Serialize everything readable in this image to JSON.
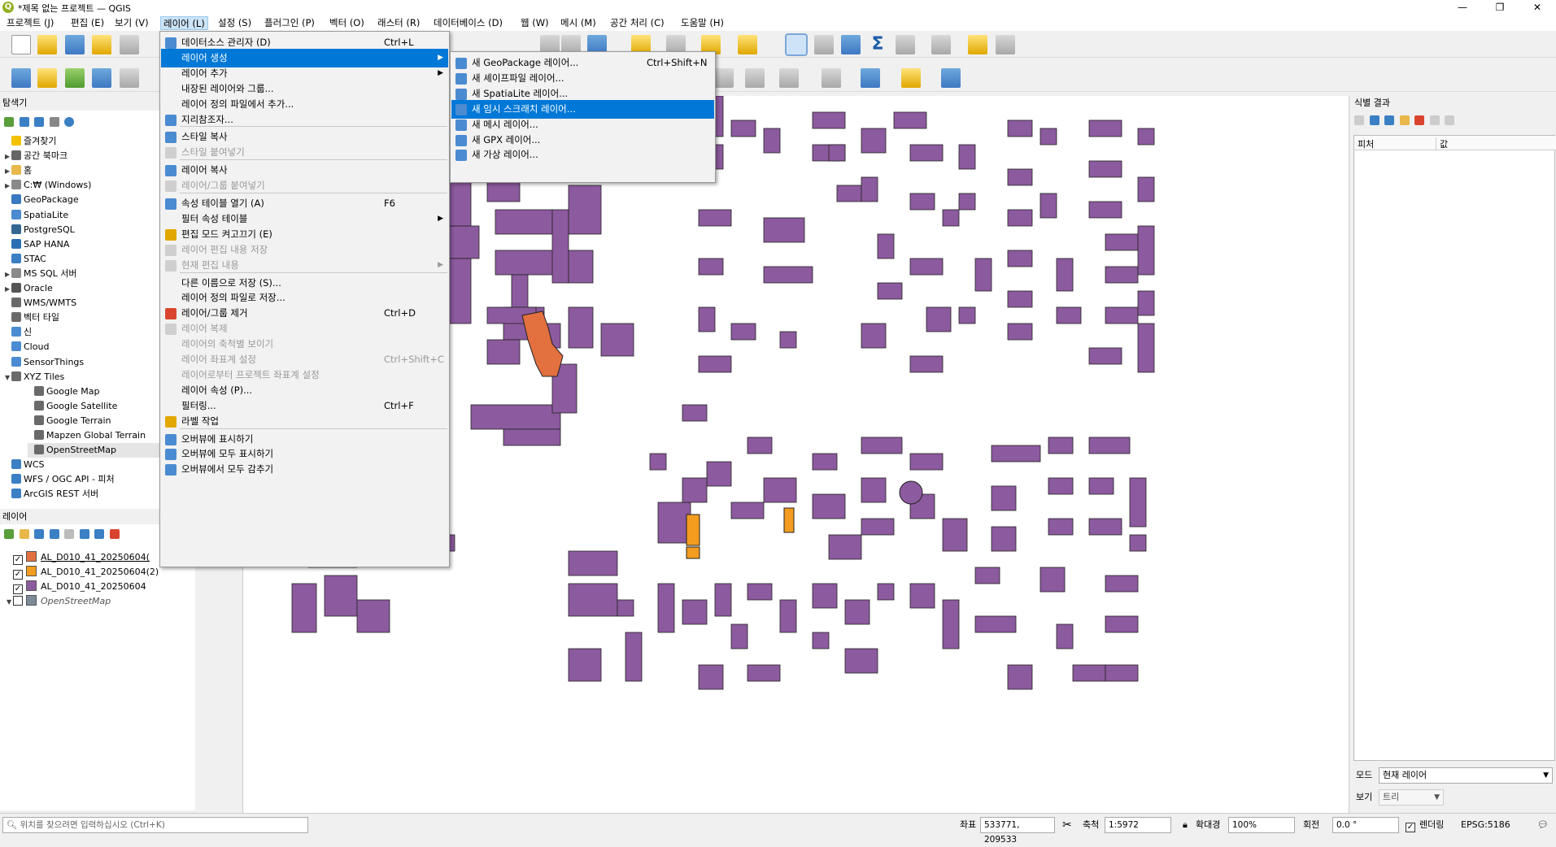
{
  "window": {
    "title": "*제목 없는 프로젝트 — QGIS",
    "logo": "Q"
  },
  "menubar": [
    "프로젝트 (J)",
    "편집 (E)",
    "보기 (V)",
    "레이어 (L)",
    "설정 (S)",
    "플러그인 (P)",
    "벡터 (O)",
    "래스터 (R)",
    "데이터베이스 (D)",
    "웹 (W)",
    "메시 (M)",
    "공간 처리 (C)",
    "도움말 (H)"
  ],
  "browser": {
    "title": "탐색기",
    "items": [
      {
        "label": "즐겨찾기",
        "icon": "star-icon",
        "color": "#f2c200",
        "arrow": ""
      },
      {
        "label": "공간 북마크",
        "icon": "bookmark-icon",
        "color": "#666666",
        "arrow": "▶"
      },
      {
        "label": "홈",
        "icon": "folder-icon",
        "color": "#e8b84a",
        "arrow": "▶"
      },
      {
        "label": "C:₩ (Windows)",
        "icon": "drive-icon",
        "color": "#8a8a8a",
        "arrow": "▶"
      },
      {
        "label": "GeoPackage",
        "icon": "geopackage-icon",
        "color": "#3a79c2",
        "arrow": ""
      },
      {
        "label": "SpatiaLite",
        "icon": "spatialite-icon",
        "color": "#4b8bd1",
        "arrow": ""
      },
      {
        "label": "PostgreSQL",
        "icon": "postgres-icon",
        "color": "#336791",
        "arrow": ""
      },
      {
        "label": "SAP HANA",
        "icon": "hana-icon",
        "color": "#2a6fb5",
        "arrow": ""
      },
      {
        "label": "STAC",
        "icon": "stac-icon",
        "color": "#3b7fc4",
        "arrow": ""
      },
      {
        "label": "MS SQL 서버",
        "icon": "mssql-icon",
        "color": "#8a8a8a",
        "arrow": "▶"
      },
      {
        "label": "Oracle",
        "icon": "oracle-icon",
        "color": "#555555",
        "arrow": "▶"
      },
      {
        "label": "WMS/WMTS",
        "icon": "wms-icon",
        "color": "#6a6a6a",
        "arrow": ""
      },
      {
        "label": "벡터 타일",
        "icon": "vector-tile-icon",
        "color": "#6a6a6a",
        "arrow": ""
      },
      {
        "label": "신",
        "icon": "scene-icon",
        "color": "#4b8bd1",
        "arrow": ""
      },
      {
        "label": "Cloud",
        "icon": "cloud-icon",
        "color": "#4b8bd1",
        "arrow": ""
      },
      {
        "label": "SensorThings",
        "icon": "sensorthings-icon",
        "color": "#4b8bd1",
        "arrow": ""
      },
      {
        "label": "XYZ Tiles",
        "icon": "xyz-tiles-icon",
        "color": "#6a6a6a",
        "arrow": "▼"
      },
      {
        "label": "Google Map",
        "icon": "grid-icon",
        "color": "#6a6a6a",
        "arrow": "",
        "indent": true
      },
      {
        "label": "Google Satellite",
        "icon": "grid-icon",
        "color": "#6a6a6a",
        "arrow": "",
        "indent": true
      },
      {
        "label": "Google Terrain",
        "icon": "grid-icon",
        "color": "#6a6a6a",
        "arrow": "",
        "indent": true
      },
      {
        "label": "Mapzen Global Terrain",
        "icon": "grid-icon",
        "color": "#6a6a6a",
        "arrow": "",
        "indent": true
      },
      {
        "label": "OpenStreetMap",
        "icon": "grid-icon",
        "color": "#6a6a6a",
        "arrow": "",
        "indent": true,
        "selected": true
      },
      {
        "label": "WCS",
        "icon": "wcs-icon",
        "color": "#3b7fc4",
        "arrow": ""
      },
      {
        "label": "WFS / OGC API - 피처",
        "icon": "wfs-icon",
        "color": "#3b7fc4",
        "arrow": ""
      },
      {
        "label": "ArcGIS REST 서버",
        "icon": "arcgis-icon",
        "color": "#3b7fc4",
        "arrow": ""
      }
    ]
  },
  "layers": {
    "title": "레이어",
    "items": [
      {
        "label": "AL_D010_41_20250604(",
        "color": "#e3703f",
        "checked": "✓",
        "italic": false
      },
      {
        "label": "AL_D010_41_20250604(2)",
        "color": "#f39c1f",
        "checked": "✓",
        "italic": false
      },
      {
        "label": "AL_D010_41_20250604",
        "color": "#8c5a9e",
        "checked": "✓",
        "italic": false
      },
      {
        "label": "OpenStreetMap",
        "color": "#7d8a99",
        "checked": "",
        "italic": true
      }
    ]
  },
  "layer_menu": [
    {
      "label": "데이터소스 관리자 (D)",
      "shortcut": "Ctrl+L",
      "icon": "datasource-icon"
    },
    {
      "label": "레이어 생성",
      "submenu": true,
      "highlight": true
    },
    {
      "label": "레이어 추가",
      "submenu": true
    },
    {
      "label": "내장된 레이어와 그룹..."
    },
    {
      "label": "레이어 정의 파일에서 추가..."
    },
    {
      "label": "지리참조자...",
      "icon": "georeferencer-icon"
    },
    {
      "sep": true
    },
    {
      "label": "스타일 복사",
      "icon": "copy-style-icon"
    },
    {
      "label": "스타일 붙여넣기",
      "disabled": true,
      "icon": "paste-style-icon"
    },
    {
      "sep": true
    },
    {
      "label": "레이어 복사",
      "icon": "copy-layer-icon"
    },
    {
      "label": "레이어/그룹 붙여넣기",
      "disabled": true,
      "icon": "paste-layer-icon"
    },
    {
      "sep": true
    },
    {
      "label": "속성 테이블 열기 (A)",
      "shortcut": "F6",
      "icon": "table-icon"
    },
    {
      "label": "필터 속성 테이블",
      "submenu": true
    },
    {
      "label": "편집 모드 켜고끄기 (E)",
      "icon": "pencil-icon"
    },
    {
      "label": "레이어 편집 내용 저장",
      "disabled": true,
      "icon": "save-edits-icon"
    },
    {
      "label": "현재 편집 내용",
      "disabled": true,
      "submenu": true,
      "icon": "current-edits-icon"
    },
    {
      "sep": true
    },
    {
      "label": "다른 이름으로 저장 (S)..."
    },
    {
      "label": "레이어 정의 파일로 저장..."
    },
    {
      "label": "레이어/그룹 제거",
      "shortcut": "Ctrl+D",
      "icon": "remove-layer-icon"
    },
    {
      "label": "레이어 복제",
      "disabled": true,
      "icon": "duplicate-icon"
    },
    {
      "label": "레이어의 축척별 보이기",
      "disabled": true
    },
    {
      "label": "레이어 좌표계 설정",
      "disabled": true,
      "shortcut": "Ctrl+Shift+C"
    },
    {
      "label": "레이어로부터 프로젝트 좌표계 설정",
      "disabled": true
    },
    {
      "label": "레이어 속성 (P)..."
    },
    {
      "label": "필터링...",
      "shortcut": "Ctrl+F"
    },
    {
      "label": "라벨 작업",
      "icon": "label-icon"
    },
    {
      "sep": true
    },
    {
      "label": "오버뷰에 표시하기",
      "icon": "overview-icon"
    },
    {
      "label": "오버뷰에 모두 표시하기",
      "icon": "overview-icon"
    },
    {
      "label": "오버뷰에서 모두 감추기",
      "icon": "overview-hide-icon"
    }
  ],
  "create_submenu": [
    {
      "label": "새 GeoPackage 레이어...",
      "shortcut": "Ctrl+Shift+N",
      "icon": "geopackage-icon"
    },
    {
      "label": "새 셰이프파일 레이어...",
      "icon": "shapefile-icon"
    },
    {
      "label": "새 SpatiaLite 레이어...",
      "icon": "spatialite-icon"
    },
    {
      "label": "새 임시 스크래치 레이어...",
      "highlight": true,
      "icon": "scratch-icon"
    },
    {
      "label": "새 메시 레이어...",
      "icon": "mesh-icon"
    },
    {
      "label": "새 GPX 레이어...",
      "icon": "gpx-icon"
    },
    {
      "label": "새 가상 레이어...",
      "icon": "virtual-icon"
    }
  ],
  "identify": {
    "title": "식별 결과",
    "columns": [
      "피처",
      "값"
    ],
    "mode_label": "모드",
    "mode_value": "현재 레이어",
    "view_label": "보기",
    "view_value": "트리"
  },
  "status": {
    "locator_placeholder": "위치를 찾으려면 입력하십시오 (Ctrl+K)",
    "coord_label": "좌표",
    "coord_value": "533771, 209533",
    "scale_label": "축척",
    "scale_value": "1:5972",
    "magnifier_label": "확대경",
    "magnifier_value": "100%",
    "rotation_label": "회전",
    "rotation_value": "0.0 °",
    "render_label": "렌더링",
    "crs": "EPSG:5186"
  },
  "colors": {
    "building_fill": "#8c5a9e",
    "selected_fill": "#e3703f",
    "orange_fill": "#f39c1f",
    "menu_highlight": "#0078d7"
  }
}
